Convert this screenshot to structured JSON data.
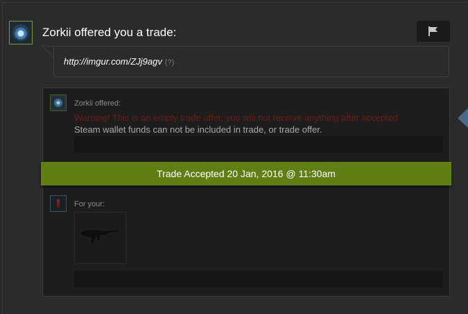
{
  "header": {
    "title": "Zorkii offered you a trade:"
  },
  "message": {
    "link_text": "http://imgur.com/ZJj9agv",
    "help_text": "(?)"
  },
  "offer": {
    "offered_label": "Zorkii offered:",
    "warning": "Warning! This is an empty trade offer, you will not receive anything after accepted",
    "wallet_note": "Steam wallet funds can not be included in trade, or trade offer."
  },
  "status": {
    "accepted_text": "Trade Accepted 20 Jan, 2016 @ 11:30am"
  },
  "your_side": {
    "for_label": "For your:",
    "item_icon": "rifle-icon"
  },
  "colors": {
    "accepted_bar": "#5f7f15",
    "warning_text": "#6e1c18",
    "background": "#2b2b2b",
    "trade_panel": "#1d1d1d"
  },
  "icons": {
    "report": "flag-icon",
    "side_nav": "triangle-left-icon"
  }
}
